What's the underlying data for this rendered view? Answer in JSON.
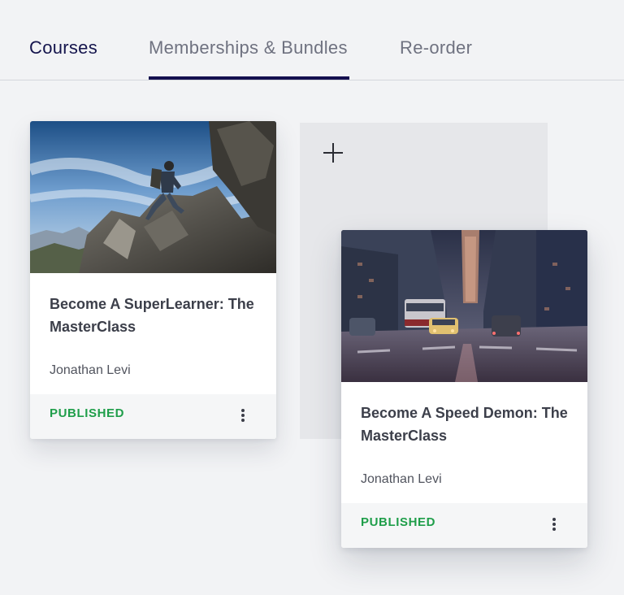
{
  "tabs": [
    {
      "label": "Courses",
      "active": true
    },
    {
      "label": "Memberships & Bundles",
      "active": false
    },
    {
      "label": "Re-order",
      "active": false
    }
  ],
  "add_course": {
    "icon": "plus-icon"
  },
  "courses": [
    {
      "title": "Become A SuperLearner: The MasterClass",
      "author": "Jonathan Levi",
      "status": "PUBLISHED",
      "thumbnail": "mountain-hiker-image",
      "menu_icon": "kebab-menu-icon"
    },
    {
      "title": "Become A Speed Demon: The MasterClass",
      "author": "Jonathan Levi",
      "status": "PUBLISHED",
      "thumbnail": "city-street-image",
      "menu_icon": "kebab-menu-icon"
    }
  ],
  "colors": {
    "active_tab": "#15154d",
    "inactive_tab": "#6f7280",
    "tab_underline": "#14104f",
    "published": "#1f9e4a",
    "background": "#f2f3f5"
  }
}
